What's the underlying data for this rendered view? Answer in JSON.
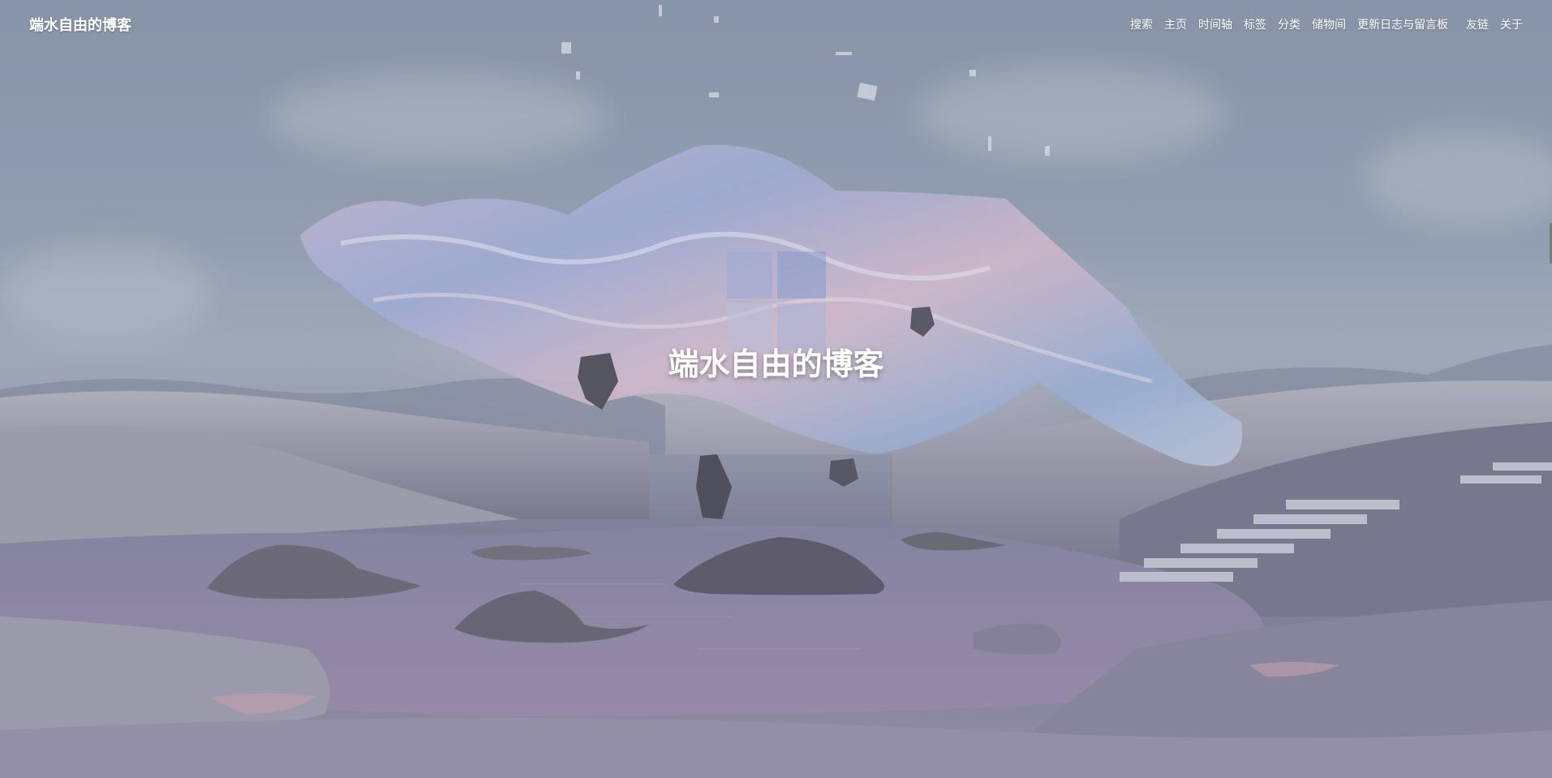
{
  "header": {
    "brand": "端水自由的博客",
    "menu": [
      "搜索",
      "主页",
      "时间轴",
      "标签",
      "分类",
      "储物间",
      "更新日志与留言板",
      "友链",
      "关于"
    ]
  },
  "hero": {
    "title": "端水自由的博客",
    "background": "abstract landscape with floating iridescent fabric, rocks, hills and pond"
  },
  "colors": {
    "nav_text": "#ffffff",
    "title_text": "#ffffff"
  }
}
